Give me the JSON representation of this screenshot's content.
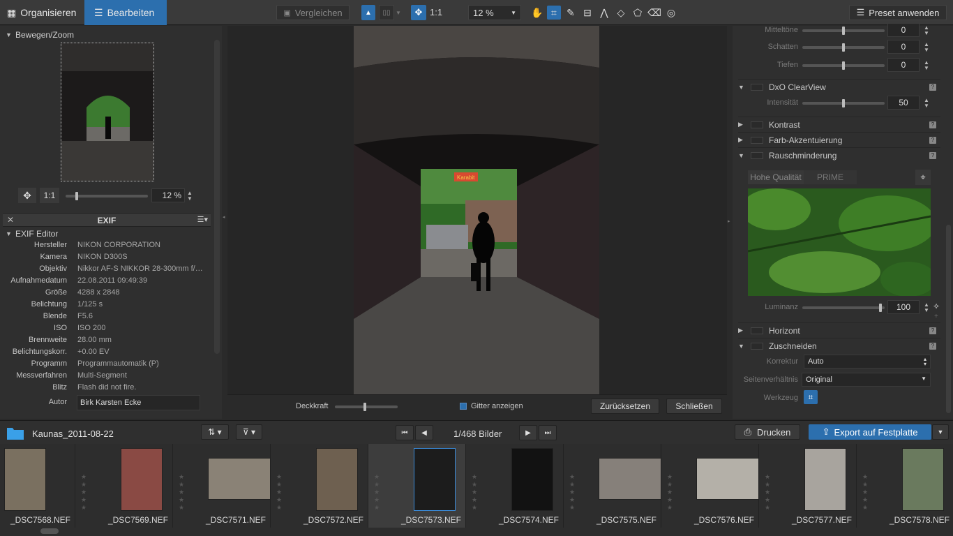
{
  "topbar": {
    "tab_organize": "Organisieren",
    "tab_edit": "Bearbeiten",
    "compare": "Vergleichen",
    "one_to_one": "1:1",
    "zoom": "12 %",
    "preset": "Preset anwenden"
  },
  "left": {
    "move_zoom_title": "Bewegen/Zoom",
    "zoom_1to1": "1:1",
    "zoom_value": "12 %",
    "zoom_fraction": 0.12,
    "exif_header": "EXIF",
    "exif_editor": "EXIF Editor",
    "exif": [
      {
        "label": "Hersteller",
        "value": "NIKON CORPORATION"
      },
      {
        "label": "Kamera",
        "value": "NIKON D300S"
      },
      {
        "label": "Objektiv",
        "value": "Nikkor AF-S NIKKOR 28-300mm f/…"
      },
      {
        "label": "Aufnahmedatum",
        "value": "22.08.2011 09:49:39"
      },
      {
        "label": "Größe",
        "value": "4288 x 2848"
      },
      {
        "label": "Belichtung",
        "value": "1/125 s"
      },
      {
        "label": "Blende",
        "value": "F5.6"
      },
      {
        "label": "ISO",
        "value": "ISO 200"
      },
      {
        "label": "Brennweite",
        "value": "28.00 mm"
      },
      {
        "label": "Belichtungskorr.",
        "value": "+0.00 EV"
      },
      {
        "label": "Programm",
        "value": "Programmautomatik (P)"
      },
      {
        "label": "Messverfahren",
        "value": "Multi-Segment"
      },
      {
        "label": "Blitz",
        "value": "Flash did not fire."
      }
    ],
    "author_label": "Autor",
    "author_value": "Birk Karsten Ecke"
  },
  "center": {
    "opacity_label": "Deckkraft",
    "grid_label": "Gitter anzeigen",
    "reset": "Zurücksetzen",
    "close": "Schließen",
    "sign_text": "Karabit"
  },
  "right": {
    "mitteltoene_label": "Mitteltöne",
    "mitteltoene_value": "0",
    "schatten_label": "Schatten",
    "schatten_value": "0",
    "tiefen_label": "Tiefen",
    "tiefen_value": "0",
    "clearview": "DxO ClearView",
    "intensity_label": "Intensität",
    "intensity_value": "50",
    "kontrast": "Kontrast",
    "farb": "Farb-Akzentuierung",
    "rausch": "Rauschminderung",
    "hq": "Hohe Qualität",
    "prime": "PRIME",
    "luminanz_label": "Luminanz",
    "luminanz_value": "100",
    "horizont": "Horizont",
    "zuschneiden": "Zuschneiden",
    "korrektur_label": "Korrektur",
    "korrektur_value": "Auto",
    "aspect_label": "Seitenverhältnis",
    "aspect_value": "Original",
    "tool_label": "Werkzeug"
  },
  "stripbar": {
    "folder": "Kaunas_2011-08-22",
    "count": "1/468 Bilder",
    "print": "Drucken",
    "export": "Export auf Festplatte"
  },
  "thumbs": [
    {
      "name": "_DSC7568.NEF",
      "color": "#7a7060"
    },
    {
      "name": "_DSC7569.NEF",
      "color": "#8a4a44"
    },
    {
      "name": "_DSC7571.NEF",
      "color": "#8a8276"
    },
    {
      "name": "_DSC7572.NEF",
      "color": "#6e6050"
    },
    {
      "name": "_DSC7573.NEF",
      "color": "#1c1c1c"
    },
    {
      "name": "_DSC7574.NEF",
      "color": "#121212"
    },
    {
      "name": "_DSC7575.NEF",
      "color": "#86807a"
    },
    {
      "name": "_DSC7576.NEF",
      "color": "#b4b0a8"
    },
    {
      "name": "_DSC7577.NEF",
      "color": "#a8a49e"
    },
    {
      "name": "_DSC7578.NEF",
      "color": "#6a7a5e"
    }
  ],
  "colors": {
    "accent": "#2c6fae"
  }
}
